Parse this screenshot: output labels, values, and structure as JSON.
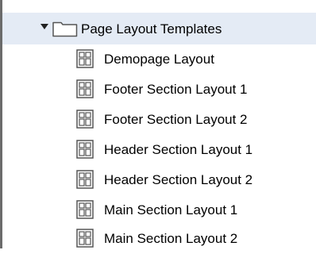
{
  "tree": {
    "folder": {
      "label": "Page Layout Templates",
      "icon": "folder-icon",
      "expanded": true,
      "highlight_color": "#e4ebf5"
    },
    "items": [
      {
        "label": "Demopage Layout",
        "icon": "layout-template-icon"
      },
      {
        "label": "Footer Section Layout 1",
        "icon": "layout-template-icon"
      },
      {
        "label": "Footer Section Layout 2",
        "icon": "layout-template-icon"
      },
      {
        "label": "Header Section Layout 1",
        "icon": "layout-template-icon"
      },
      {
        "label": "Header Section Layout 2",
        "icon": "layout-template-icon"
      },
      {
        "label": "Main Section Layout 1",
        "icon": "layout-template-icon"
      },
      {
        "label": "Main Section Layout 2",
        "icon": "layout-template-icon"
      }
    ]
  }
}
